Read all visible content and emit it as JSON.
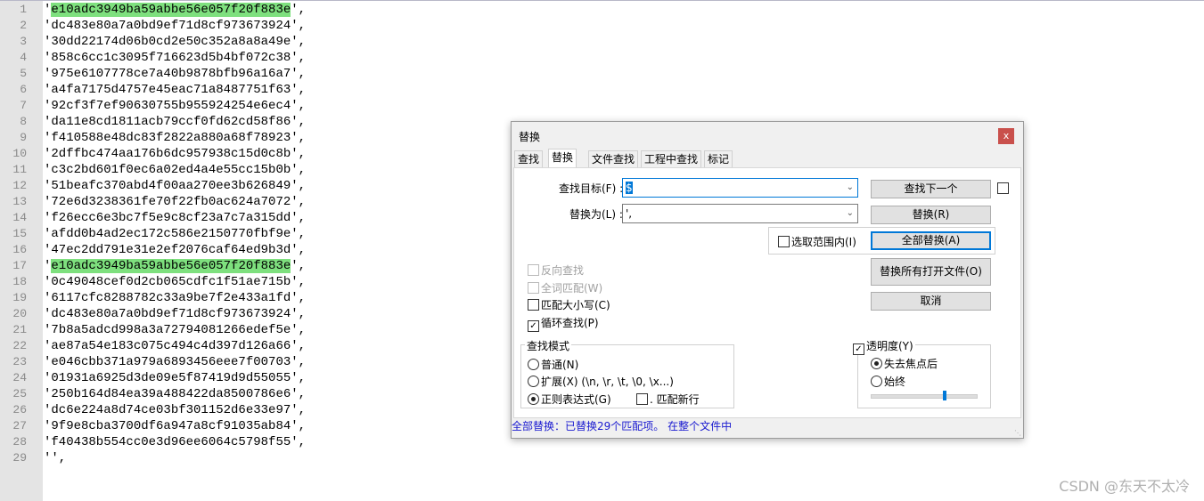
{
  "editor": {
    "lines": [
      "'e10adc3949ba59abbe56e057f20f883e',",
      "'dc483e80a7a0bd9ef71d8cf973673924',",
      "'30dd22174d06b0cd2e50c352a8a8a49e',",
      "'858c6cc1c3095f716623d5b4bf072c38',",
      "'975e6107778ce7a40b9878bfb96a16a7',",
      "'a4fa7175d4757e45eac71a8487751f63',",
      "'92cf3f7ef90630755b955924254e6ec4',",
      "'da11e8cd1811acb79ccf0fd62cd58f86',",
      "'f410588e48dc83f2822a880a68f78923',",
      "'2dffbc474aa176b6dc957938c15d0c8b',",
      "'c3c2bd601f0ec6a02ed4a4e55cc15b0b',",
      "'51beafc370abd4f00aa270ee3b626849',",
      "'72e6d3238361fe70f22fb0ac624a7072',",
      "'f26ecc6e3bc7f5e9c8cf23a7c7a315dd',",
      "'afdd0b4ad2ec172c586e2150770fbf9e',",
      "'47ec2dd791e31e2ef2076caf64ed9b3d',",
      "'e10adc3949ba59abbe56e057f20f883e',",
      "'0c49048cef0d2cb065cdfc1f51ae715b',",
      "'6117cfc8288782c33a9be7f2e433a1fd',",
      "'dc483e80a7a0bd9ef71d8cf973673924',",
      "'7b8a5adcd998a3a72794081266edef5e',",
      "'ae87a54e183c075c494c4d397d126a66',",
      "'e046cbb371a979a6893456eee7f00703',",
      "'01931a6925d3de09e5f87419d9d55055',",
      "'250b164d84ea39a488422da8500786e6',",
      "'dc6e224a8d74ce03bf301152d6e33e97',",
      "'9f9e8cba3700df6a947a8cf91035ab84',",
      "'f40438b554cc0e3d96ee6064c5798f55',",
      "'',"
    ],
    "highlighted_lines": [
      1,
      17
    ],
    "highlight_color": "#7ee07e"
  },
  "dialog": {
    "title": "替换",
    "close": "x",
    "tabs": [
      "查找",
      "替换",
      "文件查找",
      "工程中查找",
      "标记"
    ],
    "active_tab": 1,
    "find_label": "查找目标(F) :",
    "find_value": "$",
    "replace_label": "替换为(L) :",
    "replace_value": "',",
    "buttons": {
      "find_next": "查找下一个",
      "replace": "替换(R)",
      "replace_all": "全部替换(A)",
      "replace_all_open": "替换所有打开文件(O)",
      "cancel": "取消"
    },
    "in_selection": {
      "label": "选取范围内(I)",
      "checked": false
    },
    "options": [
      {
        "label": "反向查找",
        "checked": false,
        "disabled": true
      },
      {
        "label": "全词匹配(W)",
        "checked": false,
        "disabled": true
      },
      {
        "label": "匹配大小写(C)",
        "checked": false,
        "disabled": false
      },
      {
        "label": "循环查找(P)",
        "checked": true,
        "disabled": false
      }
    ],
    "search_mode": {
      "legend": "查找模式",
      "normal": "普通(N)",
      "extended": "扩展(X) (\\n, \\r, \\t, \\0, \\x...)",
      "regex": "正则表达式(G)",
      "selected": "regex",
      "dot_newline": ". 匹配新行"
    },
    "transparency": {
      "label": "透明度(Y)",
      "checked": true,
      "on_lose_focus": "失去焦点后",
      "always": "始终",
      "selected": "on_lose_focus",
      "level_percent": 70
    },
    "status": "全部替换：已替换29个匹配项。 在整个文件中"
  },
  "watermark": "CSDN @东天不太冷"
}
